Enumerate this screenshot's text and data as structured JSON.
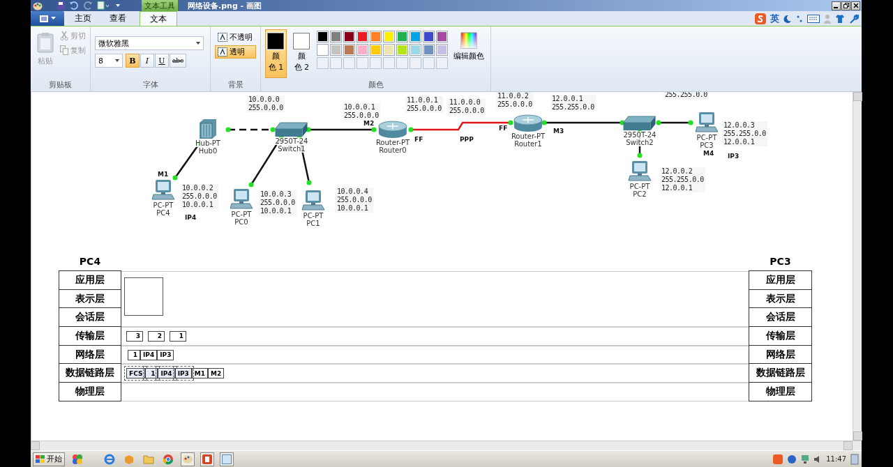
{
  "window": {
    "title": "网络设备.png - 画图",
    "context_tab": "文本工具"
  },
  "ribbon_tabs": [
    {
      "label": "主页",
      "selected": false
    },
    {
      "label": "查看",
      "selected": false
    },
    {
      "label": "文本",
      "selected": true
    }
  ],
  "clipboard": {
    "group": "剪贴板",
    "paste": {
      "label": "粘贴",
      "disabled": true
    },
    "cut": {
      "label": "剪切",
      "disabled": true
    },
    "copy": {
      "label": "复制",
      "disabled": true
    }
  },
  "font": {
    "group": "字体",
    "family": "微软雅黑",
    "size": "8",
    "styles": [
      {
        "kind": "bold",
        "label": "B",
        "selected": true
      },
      {
        "kind": "italic",
        "label": "I",
        "selected": false
      },
      {
        "kind": "underline",
        "label": "U",
        "selected": false
      },
      {
        "kind": "strike",
        "label": "abc",
        "selected": false
      }
    ]
  },
  "background": {
    "group": "背景",
    "options": [
      {
        "label": "不透明",
        "selected": false
      },
      {
        "label": "透明",
        "selected": true
      }
    ]
  },
  "colors": {
    "group": "颜色",
    "edit": "编辑颜色",
    "active": [
      {
        "label_lines": [
          "颜",
          "色 1"
        ],
        "color": "#000000",
        "selected": true
      },
      {
        "label_lines": [
          "颜",
          "色 2"
        ],
        "color": "#ffffff",
        "selected": false
      }
    ],
    "palette": [
      {
        "kind": "swatch",
        "color": "#000000"
      },
      {
        "kind": "swatch",
        "color": "#7f7f7f"
      },
      {
        "kind": "swatch",
        "color": "#880015"
      },
      {
        "kind": "swatch",
        "color": "#ed1c24"
      },
      {
        "kind": "swatch",
        "color": "#ff7f27"
      },
      {
        "kind": "swatch",
        "color": "#fff200"
      },
      {
        "kind": "swatch",
        "color": "#22b14c"
      },
      {
        "kind": "swatch",
        "color": "#00a2e8"
      },
      {
        "kind": "swatch",
        "color": "#3f48cc"
      },
      {
        "kind": "swatch",
        "color": "#a349a4"
      },
      {
        "kind": "swatch",
        "color": "#ffffff"
      },
      {
        "kind": "swatch",
        "color": "#c3c3c3"
      },
      {
        "kind": "swatch",
        "color": "#b97a57"
      },
      {
        "kind": "swatch",
        "color": "#ffaec9"
      },
      {
        "kind": "swatch",
        "color": "#ffc90e"
      },
      {
        "kind": "swatch",
        "color": "#efe4b0"
      },
      {
        "kind": "swatch",
        "color": "#b5e61d"
      },
      {
        "kind": "swatch",
        "color": "#99d9ea"
      },
      {
        "kind": "swatch",
        "color": "#7092be"
      },
      {
        "kind": "swatch",
        "color": "#c8bfe7"
      },
      {
        "kind": "empty"
      },
      {
        "kind": "empty"
      },
      {
        "kind": "empty"
      },
      {
        "kind": "empty"
      },
      {
        "kind": "empty"
      },
      {
        "kind": "empty"
      },
      {
        "kind": "empty"
      },
      {
        "kind": "empty"
      },
      {
        "kind": "empty"
      },
      {
        "kind": "empty"
      }
    ]
  },
  "ime": {
    "label": "英"
  },
  "diagram": {
    "nodes": [
      {
        "kind": "hub",
        "model": "Hub-PT",
        "name": "Hub0"
      },
      {
        "kind": "switch",
        "model": "2950T-24",
        "name": "Switch1"
      },
      {
        "kind": "router",
        "model": "Router-PT",
        "name": "Router0"
      },
      {
        "kind": "router",
        "model": "Router-PT",
        "name": "Router1"
      },
      {
        "kind": "switch",
        "model": "2950T-24",
        "name": "Switch2"
      },
      {
        "kind": "pc",
        "model": "PC-PT",
        "name": "PC3"
      },
      {
        "kind": "pc",
        "model": "PC-PT",
        "name": "PC2"
      },
      {
        "kind": "pc",
        "model": "PC-PT",
        "name": "PC4"
      },
      {
        "kind": "pc",
        "model": "PC-PT",
        "name": "PC0"
      },
      {
        "kind": "pc",
        "model": "PC-PT",
        "name": "PC1"
      }
    ],
    "links": [
      {
        "kind": "crossover"
      },
      {
        "kind": "straight"
      },
      {
        "kind": "straight"
      },
      {
        "kind": "straight"
      },
      {
        "kind": "straight"
      },
      {
        "kind": "serial"
      },
      {
        "kind": "straight"
      },
      {
        "kind": "straight"
      },
      {
        "kind": "straight"
      }
    ],
    "addresses": [
      {
        "lines": [
          "10.0.0.0",
          "255.0.0.0"
        ]
      },
      {
        "lines": [
          "10.0.0.1",
          "255.0.0.0"
        ]
      },
      {
        "lines": [
          "11.0.0.1",
          "255.0.0.0"
        ]
      },
      {
        "lines": [
          "11.0.0.0",
          "255.0.0.0"
        ]
      },
      {
        "lines": [
          "11.0.0.2",
          "255.0.0.0"
        ]
      },
      {
        "lines": [
          "12.0.0.1",
          "255.255.0.0"
        ]
      },
      {
        "lines": [
          "255.255.0.0"
        ]
      },
      {
        "lines": [
          "12.0.0.3",
          "255.255.0.0",
          "12.0.0.1"
        ]
      },
      {
        "lines": [
          "12.0.0.2",
          "255.255.0.0",
          "12.0.0.1"
        ]
      },
      {
        "lines": [
          "10.0.0.2",
          "255.0.0.0",
          "10.0.0.1"
        ]
      },
      {
        "lines": [
          "10.0.0.3",
          "255.0.0.0",
          "10.0.0.1"
        ]
      },
      {
        "lines": [
          "10.0.0.4",
          "255.0.0.0",
          "10.0.0.1"
        ]
      }
    ],
    "tags": [
      "M1",
      "M2",
      "FF",
      "PPP",
      "FF",
      "M3",
      "M4",
      "IP3",
      "IP4"
    ]
  },
  "stack": {
    "left_title": "PC4",
    "right_title": "PC3",
    "layers": [
      {
        "left": "应用层",
        "right": "应用层"
      },
      {
        "left": "表示层",
        "right": "表示层"
      },
      {
        "left": "会话层",
        "right": "会话层"
      },
      {
        "left": "传输层",
        "right": "传输层",
        "kind": "blocks",
        "cells": [
          {
            "text": "3"
          },
          {
            "text": "2"
          },
          {
            "text": "1"
          }
        ]
      },
      {
        "left": "网络层",
        "right": "网络层",
        "kind": "packet",
        "cells": [
          {
            "text": "1"
          },
          {
            "text": "IP4"
          },
          {
            "text": "IP3"
          }
        ]
      },
      {
        "left": "数据链路层",
        "right": "数据链路层",
        "kind": "packet",
        "cells": [
          {
            "text": "FCS",
            "selected": true
          },
          {
            "text": "1",
            "selected": true
          },
          {
            "text": "IP4",
            "selected": true
          },
          {
            "text": "IP3",
            "selected": true
          },
          {
            "text": "M1",
            "selected": false
          },
          {
            "text": "M2",
            "selected": false
          }
        ]
      },
      {
        "left": "物理层",
        "right": "物理层"
      }
    ]
  },
  "taskbar": {
    "start": "开始",
    "clock": "11:47"
  }
}
